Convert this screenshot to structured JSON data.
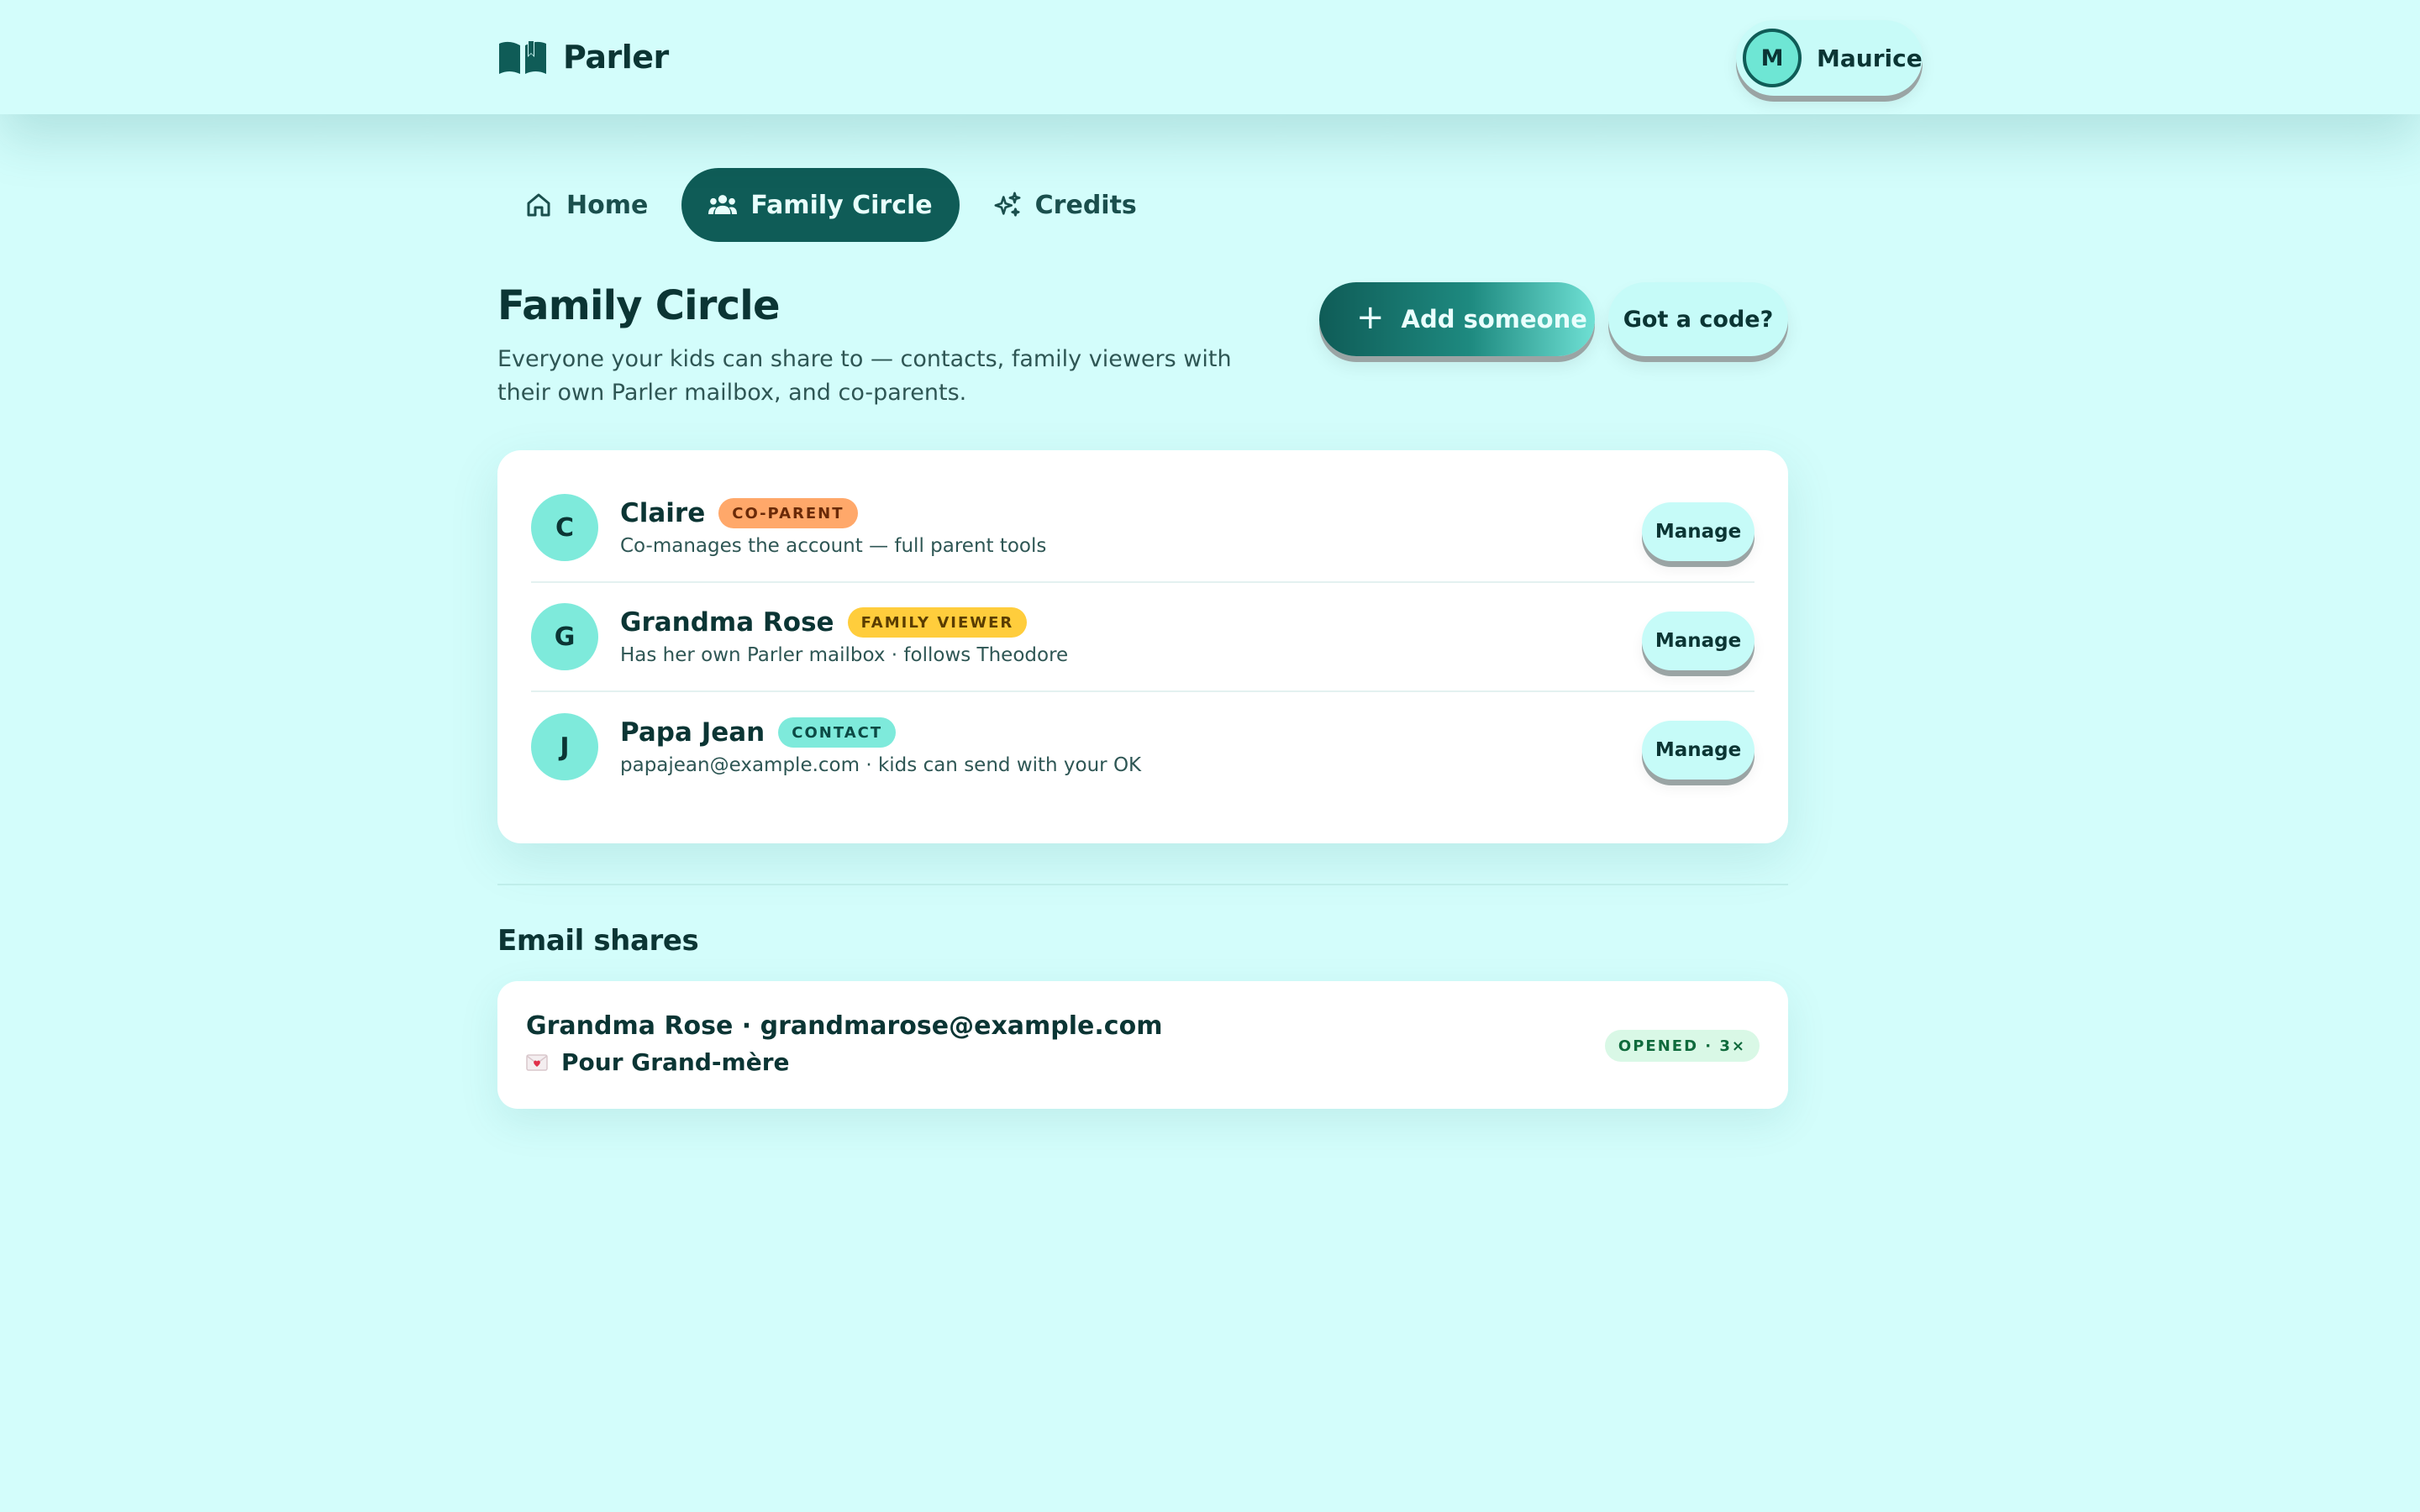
{
  "app": {
    "name": "Parler",
    "logo_icon": "open-book-icon"
  },
  "user": {
    "initial": "M",
    "name": "Maurice"
  },
  "nav": {
    "tabs": [
      {
        "label": "Home",
        "icon": "home-icon",
        "active": false
      },
      {
        "label": "Family Circle",
        "icon": "people-icon",
        "active": true
      },
      {
        "label": "Credits",
        "icon": "sparkles-icon",
        "active": false
      }
    ]
  },
  "page": {
    "title": "Family Circle",
    "subtitle": "Everyone your kids can share to — contacts, family viewers with their own Parler mailbox, and co-parents.",
    "add_button_label": "Add someone",
    "code_button_label": "Got a code?"
  },
  "people": [
    {
      "initial": "C",
      "name": "Claire",
      "badge": "CO-PARENT",
      "badge_color": "#ffa86a",
      "description": "Co-manages the account — full parent tools",
      "action_label": "Manage"
    },
    {
      "initial": "G",
      "name": "Grandma Rose",
      "badge": "FAMILY VIEWER",
      "badge_color": "#ffcd3c",
      "description": "Has her own Parler mailbox · follows Theodore",
      "action_label": "Manage"
    },
    {
      "initial": "J",
      "name": "Papa Jean",
      "badge": "CONTACT",
      "badge_color": "#7eeadb",
      "description": "papajean@example.com · kids can send with your OK",
      "action_label": "Manage"
    }
  ],
  "email_shares": {
    "section_title": "Email shares",
    "items": [
      {
        "title": "Grandma Rose · grandmarose@example.com",
        "icon": "love-letter-icon",
        "subject": "Pour Grand-mère",
        "status": "OPENED · 3×"
      }
    ]
  },
  "colors": {
    "background": "#d3fdfb",
    "primary": "#0f5c57",
    "accent": "#7eeadb"
  }
}
